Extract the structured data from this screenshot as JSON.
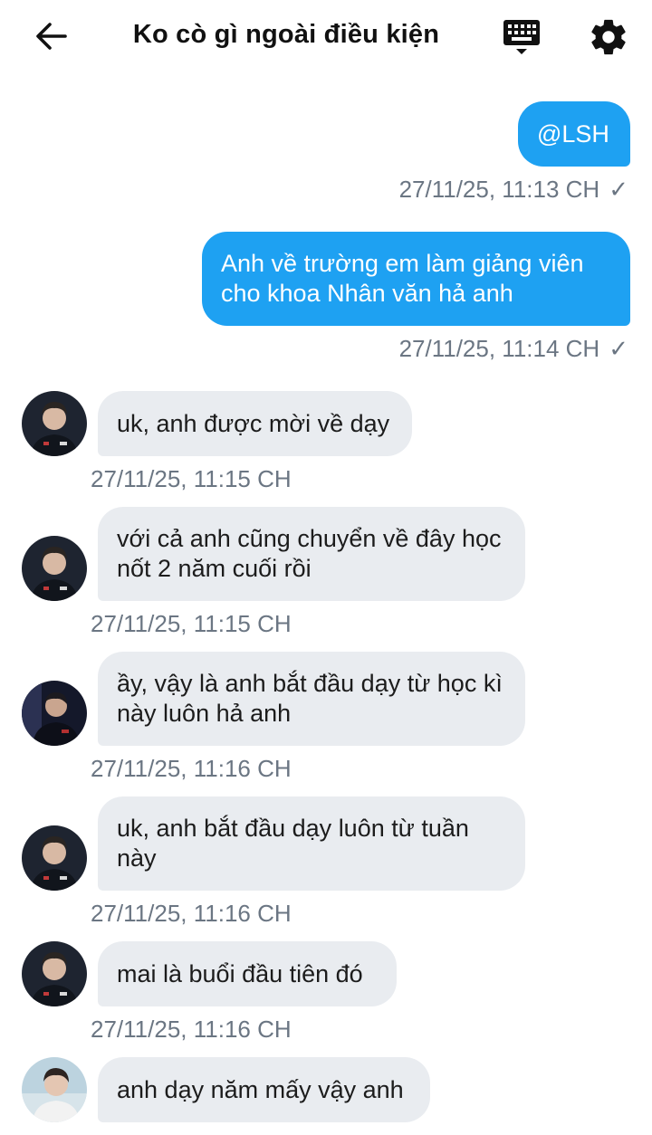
{
  "header": {
    "title": "Ko cò gì ngoài điều kiện"
  },
  "messages": [
    {
      "dir": "out",
      "text": "@LSH",
      "time": "27/11/25, 11:13 CH",
      "status": "✓"
    },
    {
      "dir": "out",
      "text": "Anh về trường em làm giảng viên cho khoa Nhân văn hả anh",
      "time": "27/11/25, 11:14 CH",
      "status": "✓"
    },
    {
      "dir": "in",
      "text": "uk, anh được mời về dạy",
      "time": "27/11/25, 11:15 CH"
    },
    {
      "dir": "in",
      "text": "với cả anh cũng chuyển về đây học nốt 2 năm cuối rồi",
      "time": "27/11/25, 11:15 CH"
    },
    {
      "dir": "in",
      "text": "ầy, vậy là anh bắt đầu dạy từ học kì này luôn hả anh",
      "time": "27/11/25, 11:16 CH"
    },
    {
      "dir": "in",
      "text": "uk, anh bắt đầu dạy luôn từ tuần này",
      "time": "27/11/25, 11:16 CH"
    },
    {
      "dir": "in",
      "text": "mai là buổi đầu tiên đó",
      "time": "27/11/25, 11:16 CH"
    },
    {
      "dir": "in",
      "text": "anh dạy năm mấy vậy anh"
    }
  ],
  "colors": {
    "outgoing_bubble": "#1ea1f2",
    "incoming_bubble": "#e9ecf0",
    "timestamp": "#6b7683"
  },
  "icons": [
    "back-arrow-icon",
    "keyboard-icon",
    "gear-icon",
    "check-icon"
  ]
}
